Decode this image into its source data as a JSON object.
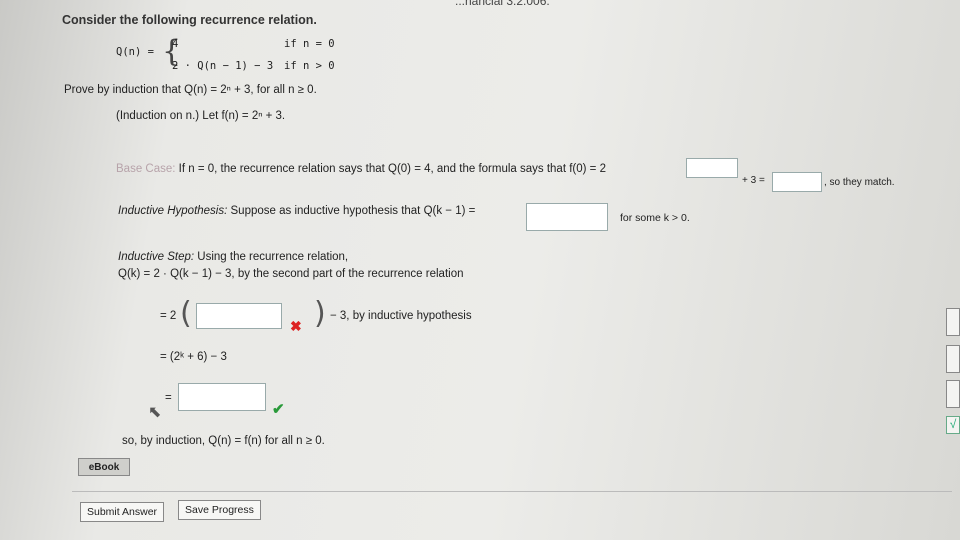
{
  "header_fragment": "...nancial 3.2.006.",
  "problem": {
    "title": "Consider the following recurrence relation.",
    "lhs": "Q(n) =",
    "case1_value": "4",
    "case1_cond": "if n = 0",
    "case2_value": "2 · Q(n − 1) − 3",
    "case2_cond": "if n > 0",
    "prove": "Prove by induction that  Q(n) = 2ⁿ + 3,  for all n ≥ 0.",
    "induction_note": "(Induction on n.) Let  f(n) = 2ⁿ + 3."
  },
  "base_case": {
    "label": "Base Case:",
    "text1": " If n = 0,  the recurrence relation says that  Q(0) = 4,  and the formula says that  f(0) = 2",
    "plus3": "+ 3 =",
    "match": ", so they match."
  },
  "hypothesis": {
    "label": "Inductive Hypothesis:",
    "text": " Suppose as inductive hypothesis that Q(k − 1) =",
    "for_some": "for some  k > 0."
  },
  "step": {
    "label": "Inductive Step:",
    "text": " Using the recurrence relation,",
    "line": "Q(k)  =  2 · Q(k − 1) − 3,  by the second part of the recurrence relation",
    "eq1_prefix": "= 2",
    "eq1_suffix": "− 3, by inductive hypothesis",
    "eq2": "= (2ᵏ + 6) − 3",
    "eq3_prefix": "=",
    "conclusion": "so, by induction,  Q(n) = f(n)  for all  n ≥ 0."
  },
  "marks": {
    "wrong": "✖",
    "right": "✔"
  },
  "buttons": {
    "ebook": "eBook",
    "submit": "Submit Answer",
    "save": "Save Progress"
  },
  "side_check": "√"
}
